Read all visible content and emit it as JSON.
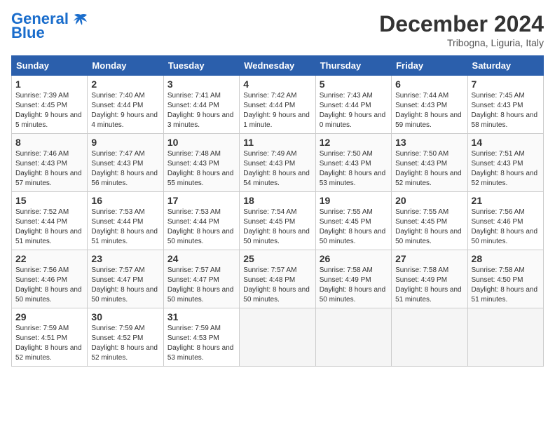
{
  "header": {
    "logo_line1": "General",
    "logo_line2": "Blue",
    "month": "December 2024",
    "location": "Tribogna, Liguria, Italy"
  },
  "weekdays": [
    "Sunday",
    "Monday",
    "Tuesday",
    "Wednesday",
    "Thursday",
    "Friday",
    "Saturday"
  ],
  "weeks": [
    [
      {
        "day": "1",
        "sunrise": "Sunrise: 7:39 AM",
        "sunset": "Sunset: 4:45 PM",
        "daylight": "Daylight: 9 hours and 5 minutes."
      },
      {
        "day": "2",
        "sunrise": "Sunrise: 7:40 AM",
        "sunset": "Sunset: 4:44 PM",
        "daylight": "Daylight: 9 hours and 4 minutes."
      },
      {
        "day": "3",
        "sunrise": "Sunrise: 7:41 AM",
        "sunset": "Sunset: 4:44 PM",
        "daylight": "Daylight: 9 hours and 3 minutes."
      },
      {
        "day": "4",
        "sunrise": "Sunrise: 7:42 AM",
        "sunset": "Sunset: 4:44 PM",
        "daylight": "Daylight: 9 hours and 1 minute."
      },
      {
        "day": "5",
        "sunrise": "Sunrise: 7:43 AM",
        "sunset": "Sunset: 4:44 PM",
        "daylight": "Daylight: 9 hours and 0 minutes."
      },
      {
        "day": "6",
        "sunrise": "Sunrise: 7:44 AM",
        "sunset": "Sunset: 4:43 PM",
        "daylight": "Daylight: 8 hours and 59 minutes."
      },
      {
        "day": "7",
        "sunrise": "Sunrise: 7:45 AM",
        "sunset": "Sunset: 4:43 PM",
        "daylight": "Daylight: 8 hours and 58 minutes."
      }
    ],
    [
      {
        "day": "8",
        "sunrise": "Sunrise: 7:46 AM",
        "sunset": "Sunset: 4:43 PM",
        "daylight": "Daylight: 8 hours and 57 minutes."
      },
      {
        "day": "9",
        "sunrise": "Sunrise: 7:47 AM",
        "sunset": "Sunset: 4:43 PM",
        "daylight": "Daylight: 8 hours and 56 minutes."
      },
      {
        "day": "10",
        "sunrise": "Sunrise: 7:48 AM",
        "sunset": "Sunset: 4:43 PM",
        "daylight": "Daylight: 8 hours and 55 minutes."
      },
      {
        "day": "11",
        "sunrise": "Sunrise: 7:49 AM",
        "sunset": "Sunset: 4:43 PM",
        "daylight": "Daylight: 8 hours and 54 minutes."
      },
      {
        "day": "12",
        "sunrise": "Sunrise: 7:50 AM",
        "sunset": "Sunset: 4:43 PM",
        "daylight": "Daylight: 8 hours and 53 minutes."
      },
      {
        "day": "13",
        "sunrise": "Sunrise: 7:50 AM",
        "sunset": "Sunset: 4:43 PM",
        "daylight": "Daylight: 8 hours and 52 minutes."
      },
      {
        "day": "14",
        "sunrise": "Sunrise: 7:51 AM",
        "sunset": "Sunset: 4:43 PM",
        "daylight": "Daylight: 8 hours and 52 minutes."
      }
    ],
    [
      {
        "day": "15",
        "sunrise": "Sunrise: 7:52 AM",
        "sunset": "Sunset: 4:44 PM",
        "daylight": "Daylight: 8 hours and 51 minutes."
      },
      {
        "day": "16",
        "sunrise": "Sunrise: 7:53 AM",
        "sunset": "Sunset: 4:44 PM",
        "daylight": "Daylight: 8 hours and 51 minutes."
      },
      {
        "day": "17",
        "sunrise": "Sunrise: 7:53 AM",
        "sunset": "Sunset: 4:44 PM",
        "daylight": "Daylight: 8 hours and 50 minutes."
      },
      {
        "day": "18",
        "sunrise": "Sunrise: 7:54 AM",
        "sunset": "Sunset: 4:45 PM",
        "daylight": "Daylight: 8 hours and 50 minutes."
      },
      {
        "day": "19",
        "sunrise": "Sunrise: 7:55 AM",
        "sunset": "Sunset: 4:45 PM",
        "daylight": "Daylight: 8 hours and 50 minutes."
      },
      {
        "day": "20",
        "sunrise": "Sunrise: 7:55 AM",
        "sunset": "Sunset: 4:45 PM",
        "daylight": "Daylight: 8 hours and 50 minutes."
      },
      {
        "day": "21",
        "sunrise": "Sunrise: 7:56 AM",
        "sunset": "Sunset: 4:46 PM",
        "daylight": "Daylight: 8 hours and 50 minutes."
      }
    ],
    [
      {
        "day": "22",
        "sunrise": "Sunrise: 7:56 AM",
        "sunset": "Sunset: 4:46 PM",
        "daylight": "Daylight: 8 hours and 50 minutes."
      },
      {
        "day": "23",
        "sunrise": "Sunrise: 7:57 AM",
        "sunset": "Sunset: 4:47 PM",
        "daylight": "Daylight: 8 hours and 50 minutes."
      },
      {
        "day": "24",
        "sunrise": "Sunrise: 7:57 AM",
        "sunset": "Sunset: 4:47 PM",
        "daylight": "Daylight: 8 hours and 50 minutes."
      },
      {
        "day": "25",
        "sunrise": "Sunrise: 7:57 AM",
        "sunset": "Sunset: 4:48 PM",
        "daylight": "Daylight: 8 hours and 50 minutes."
      },
      {
        "day": "26",
        "sunrise": "Sunrise: 7:58 AM",
        "sunset": "Sunset: 4:49 PM",
        "daylight": "Daylight: 8 hours and 50 minutes."
      },
      {
        "day": "27",
        "sunrise": "Sunrise: 7:58 AM",
        "sunset": "Sunset: 4:49 PM",
        "daylight": "Daylight: 8 hours and 51 minutes."
      },
      {
        "day": "28",
        "sunrise": "Sunrise: 7:58 AM",
        "sunset": "Sunset: 4:50 PM",
        "daylight": "Daylight: 8 hours and 51 minutes."
      }
    ],
    [
      {
        "day": "29",
        "sunrise": "Sunrise: 7:59 AM",
        "sunset": "Sunset: 4:51 PM",
        "daylight": "Daylight: 8 hours and 52 minutes."
      },
      {
        "day": "30",
        "sunrise": "Sunrise: 7:59 AM",
        "sunset": "Sunset: 4:52 PM",
        "daylight": "Daylight: 8 hours and 52 minutes."
      },
      {
        "day": "31",
        "sunrise": "Sunrise: 7:59 AM",
        "sunset": "Sunset: 4:53 PM",
        "daylight": "Daylight: 8 hours and 53 minutes."
      },
      null,
      null,
      null,
      null
    ]
  ]
}
